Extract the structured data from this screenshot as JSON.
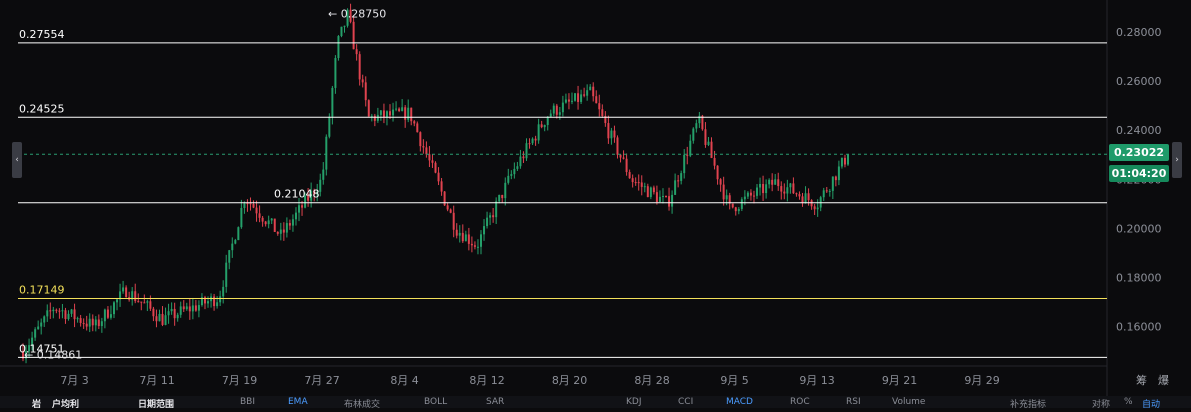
{
  "chart_data": {
    "type": "candlestick",
    "x_ticks": [
      "7月 3",
      "7月 11",
      "7月 19",
      "7月 27",
      "8月 4",
      "8月 12",
      "8月 20",
      "8月 28",
      "9月 5",
      "9月 13",
      "9月 21",
      "9月 29"
    ],
    "y_ticks": [
      "0.28000",
      "0.26000",
      "0.24000",
      "0.22000",
      "0.20000",
      "0.18000",
      "0.16000"
    ],
    "ylim": [
      0.144,
      0.293
    ],
    "horizontal_lines": [
      {
        "value": 0.27554,
        "label": "0.27554",
        "color": "#ffffff"
      },
      {
        "value": 0.24525,
        "label": "0.24525",
        "color": "#ffffff"
      },
      {
        "value": 0.21048,
        "label": "0.21048",
        "color": "#ffffff"
      },
      {
        "value": 0.17149,
        "label": "0.17149",
        "color": "#f3e05a"
      },
      {
        "value": 0.14751,
        "label": "0.14751",
        "color": "#ffffff"
      }
    ],
    "annotations": {
      "high": "← 0.28750",
      "low": "← 0.14861"
    },
    "current_price": "0.23022",
    "countdown": "01:04:20",
    "current_value": 0.23022,
    "colors": {
      "up": "#25a06a",
      "down": "#e0434f",
      "current": "#1f9b6a"
    },
    "path": [
      [
        0,
        0.15
      ],
      [
        6,
        0.168
      ],
      [
        14,
        0.16
      ],
      [
        20,
        0.175
      ],
      [
        27,
        0.163
      ],
      [
        38,
        0.172
      ],
      [
        43,
        0.213
      ],
      [
        50,
        0.197
      ],
      [
        58,
        0.22
      ],
      [
        61,
        0.275
      ],
      [
        63,
        0.287
      ],
      [
        67,
        0.245
      ],
      [
        75,
        0.247
      ],
      [
        84,
        0.2
      ],
      [
        88,
        0.193
      ],
      [
        95,
        0.223
      ],
      [
        102,
        0.247
      ],
      [
        110,
        0.255
      ],
      [
        118,
        0.22
      ],
      [
        125,
        0.21
      ],
      [
        131,
        0.244
      ],
      [
        137,
        0.208
      ],
      [
        146,
        0.219
      ],
      [
        154,
        0.21
      ],
      [
        160,
        0.23
      ]
    ]
  },
  "bottom_toolbar": {
    "items": [
      "岩",
      "户均利",
      "日期范围",
      "BBI",
      "EMA",
      "布林成交",
      "BOLL",
      "SAR",
      "KDJ",
      "CCI",
      "MACD",
      "ROC",
      "RSI",
      "Volume",
      "补充指标",
      "对称",
      "%",
      "自动"
    ],
    "corner": [
      "筹",
      "爆"
    ]
  }
}
